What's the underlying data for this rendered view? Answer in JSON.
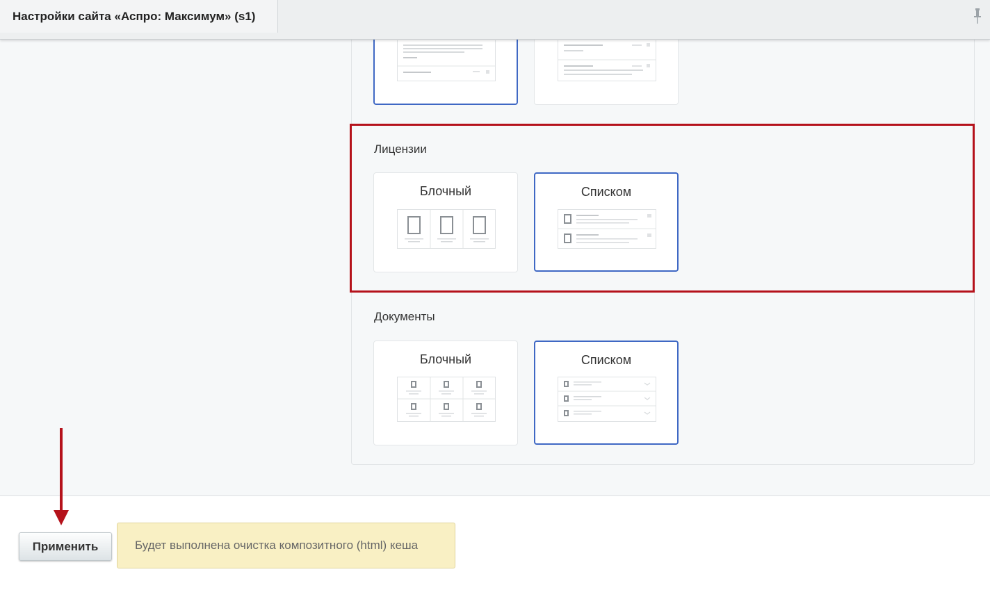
{
  "header": {
    "title": "Настройки сайта «Аспро: Максимум» (s1)"
  },
  "sections": [
    {
      "title": "Лицензии",
      "options": [
        {
          "label": "Блочный",
          "selected": false
        },
        {
          "label": "Списком",
          "selected": true
        }
      ]
    },
    {
      "title": "Документы",
      "options": [
        {
          "label": "Блочный",
          "selected": false
        },
        {
          "label": "Списком",
          "selected": true
        }
      ]
    }
  ],
  "footer": {
    "apply_label": "Применить",
    "notice": "Будет выполнена очистка композитного (html) кеша"
  },
  "colors": {
    "accent": "#3f68c4",
    "highlight": "#b5121b",
    "notice_bg": "#f9f0c4"
  },
  "icons": [
    "pin-icon",
    "arrow-down-icon"
  ]
}
